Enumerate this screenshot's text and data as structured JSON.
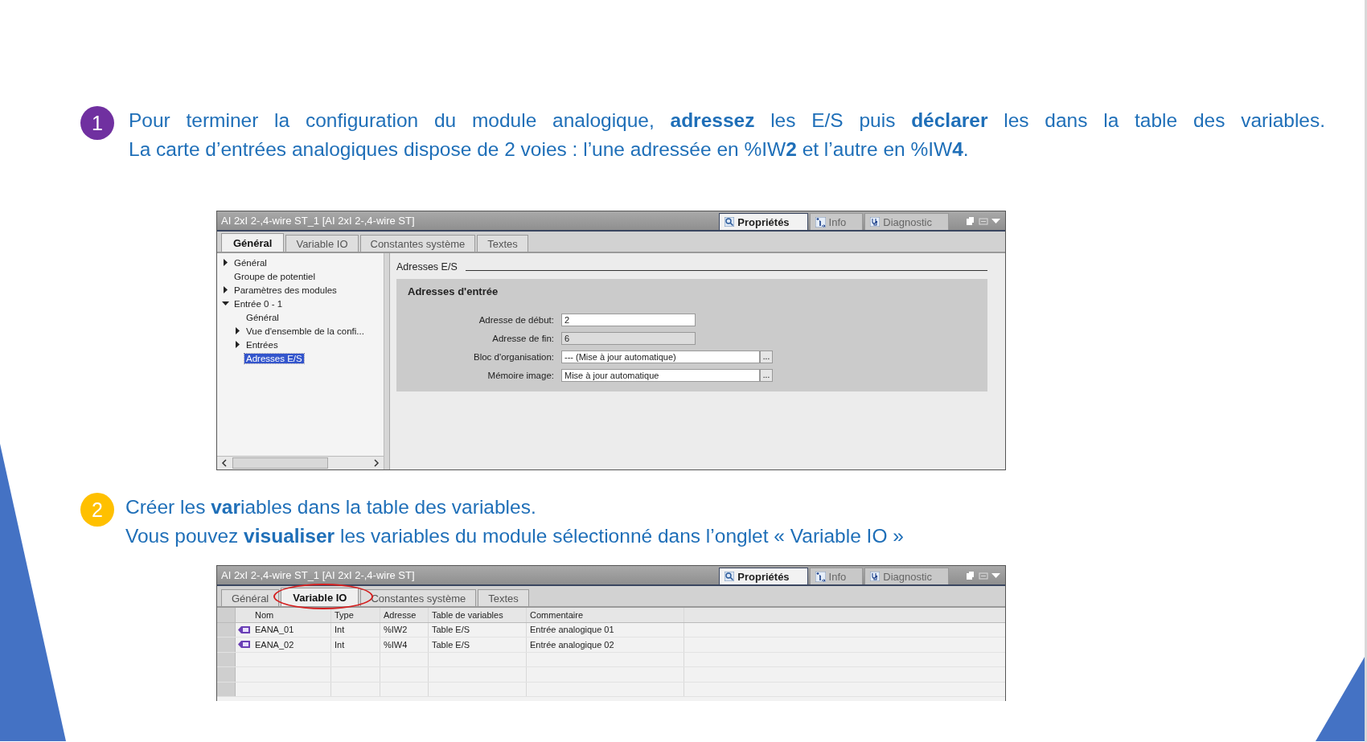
{
  "steps": [
    {
      "number": "1",
      "color": "#7030a0",
      "lines": [
        "Pour terminer la configuration du module analogique, **adressez** les E/S puis **déclarer** les dans la table des variables.",
        "La carte d’entrées analogiques dispose de 2 voies : l’une adressée en %IW**2** et l’autre en %IW**4**."
      ]
    },
    {
      "number": "2",
      "color": "#ffc000",
      "lines": [
        "Créer les **var**iables dans la table des variables.",
        "Vous pouvez **visualiser** les variables du module sélectionné dans l’onglet « Variable IO »"
      ]
    }
  ],
  "panels": [
    {
      "kind": "form",
      "title": "AI 2xI 2-,4-wire ST_1 [AI 2xI 2-,4-wire ST]",
      "view_tabs": [
        {
          "label": "Propriétés",
          "selected": true
        },
        {
          "label": "Info",
          "selected": false
        },
        {
          "label": "Diagnostic",
          "selected": false
        }
      ],
      "tabs": [
        {
          "label": "Général",
          "selected": true,
          "circled": false
        },
        {
          "label": "Variable IO",
          "selected": false,
          "circled": false
        },
        {
          "label": "Constantes système",
          "selected": false,
          "circled": false
        },
        {
          "label": "Textes",
          "selected": false,
          "circled": false
        }
      ],
      "tree": [
        {
          "label": "Général",
          "expanded": false,
          "selected": false
        },
        {
          "label": "Groupe de potentiel",
          "selected": false
        },
        {
          "label": "Paramètres des modules",
          "expanded": false,
          "selected": false
        },
        {
          "label": "Entrée 0 - 1",
          "expanded": true,
          "selected": false,
          "children": [
            {
              "label": "Général",
              "selected": false
            },
            {
              "label": "Vue d'ensemble de la confi...",
              "expanded": false,
              "selected": false
            },
            {
              "label": "Entrées",
              "expanded": false,
              "selected": false
            },
            {
              "label": "Adresses E/S",
              "selected": true
            }
          ]
        }
      ],
      "section": "Adresses E/S",
      "group": "Adresses d'entrée",
      "fields": [
        {
          "label": "Adresse de début:",
          "value": "2",
          "disabled": false
        },
        {
          "label": "Adresse de fin:",
          "value": "6",
          "disabled": true
        },
        {
          "label": "Bloc d'organisation:",
          "value": "--- (Mise à jour automatique)",
          "disabled": false,
          "button": "..."
        },
        {
          "label": "Mémoire image:",
          "value": "Mise à jour automatique",
          "disabled": false,
          "button": "..."
        }
      ]
    },
    {
      "kind": "table",
      "title": "AI 2xI 2-,4-wire ST_1 [AI 2xI 2-,4-wire ST]",
      "view_tabs": [
        {
          "label": "Propriétés",
          "selected": true
        },
        {
          "label": "Info",
          "selected": false
        },
        {
          "label": "Diagnostic",
          "selected": false
        }
      ],
      "tabs": [
        {
          "label": "Général",
          "selected": false,
          "circled": false
        },
        {
          "label": "Variable IO",
          "selected": true,
          "circled": true
        },
        {
          "label": "Constantes système",
          "selected": false,
          "circled": false
        },
        {
          "label": "Textes",
          "selected": false,
          "circled": false
        }
      ],
      "columns": [
        "Nom",
        "Type",
        "Adresse",
        "Table de variables",
        "Commentaire"
      ],
      "rows": [
        {
          "cells": [
            "EANA_01",
            "Int",
            "%IW2",
            "Table E/S",
            "Entrée analogique 01"
          ]
        },
        {
          "cells": [
            "EANA_02",
            "Int",
            "%IW4",
            "Table E/S",
            "Entrée analogique 02"
          ]
        }
      ]
    }
  ]
}
